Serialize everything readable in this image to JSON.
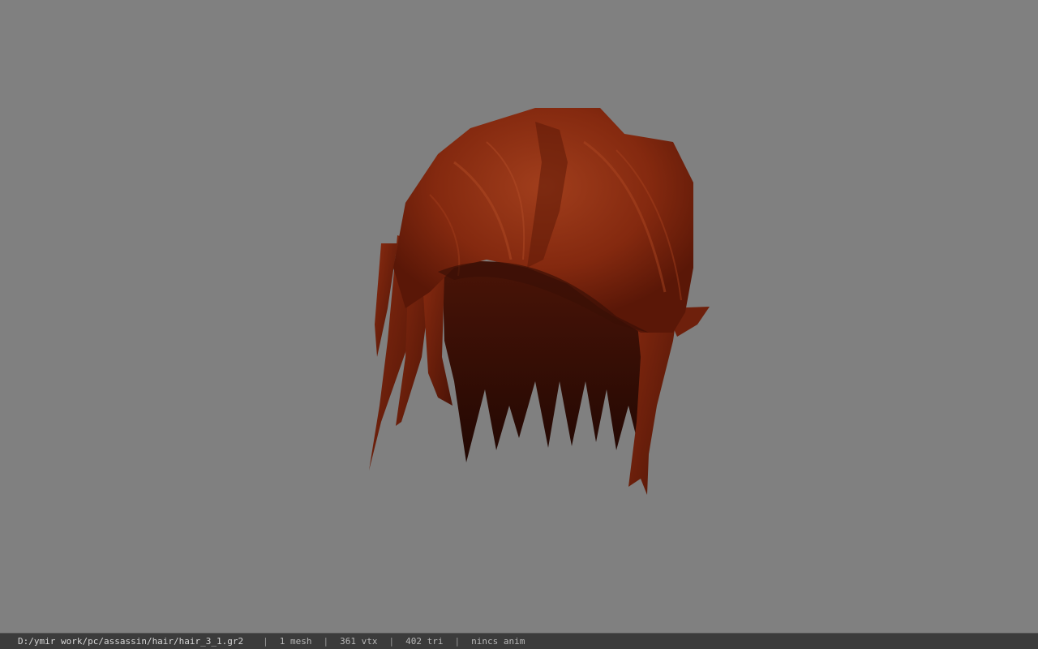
{
  "statusbar": {
    "file_path": "D:/ymir work/pc/assassin/hair/hair_3_1.gr2",
    "separator": "|",
    "mesh_count": "1 mesh",
    "vertex_count": "361 vtx",
    "triangle_count": "402 tri",
    "anim_status": "nincs anim"
  },
  "viewport": {
    "background_color": "#808080",
    "model_name": "hair model",
    "model_colors": {
      "base": "#7a2410",
      "highlight": "#a3401e",
      "shadow": "#2a0a04"
    }
  }
}
